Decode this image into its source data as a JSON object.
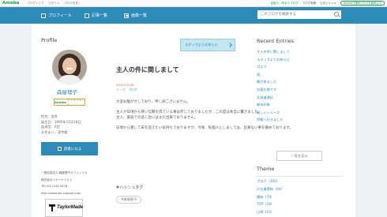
{
  "topbar": {
    "logo": "Ameba",
    "links": [
      "ブログトップ",
      "ログイン",
      "ブログを書く"
    ],
    "right_links": [
      "芸能人・有名人ブログ",
      "ブログ新着",
      "公式ジャンル"
    ],
    "signup_label": "Amebaで無料ブログを始めよう"
  },
  "nav": {
    "profile_label": "プロフィール",
    "entries_label": "記事一覧",
    "images_label": "画像一覧"
  },
  "search": {
    "placeholder": "このブログを検索する"
  },
  "profile": {
    "heading": "Profile",
    "name": "森屋理子",
    "badge_prefix": "Ameba",
    "badge_suffix": "オフィシャル",
    "info": [
      "性別：女性",
      "誕生日：1995年11月18日",
      "血液型：A型",
      "お住まい：東京都"
    ],
    "readers_button": "読者になる",
    "company_lines": [
      "一般社団法人 森屋理子オフィシャル",
      "株式会社ジャーナリスト",
      "TEL:03-1234-5678",
      "http://www.tee-support.com"
    ],
    "sponsor_logo": "TaylorMade"
  },
  "article": {
    "staff_button": "スタッフよりお知らせ",
    "title": "主人の件に関しまして",
    "meta_tag": "テーマ：",
    "meta_date": "2019-03-08",
    "meta_theme": "ブログ",
    "paragraphs": [
      [
        "大変お騒がせしており、申し訳ございません。"
      ],
      [
        "主人が日頃から厚い信頼を得ている事は存じておりましたが、この度は本当に驚きました。",
        "主人、家族での話し合いはまだ出来ておりません。"
      ],
      [
        "日頃から豊して末を迎えたい気持ちでおりますが、今後、私個人としましては、出来ない事を静めております。"
      ]
    ],
    "hashtag_heading": "#ハッシュタグ",
    "hashtag": "#森屋理子"
  },
  "recent": {
    "heading": "Recent Entries",
    "items": [
      "主人の件に関しまして",
      "スタッフよりお知らせ",
      "ゴルフ",
      "雨",
      "春が来ました",
      "お疲れ様です",
      "北海道遠征",
      "御朱印帳",
      "新しいシューズ",
      "京都へ行きました"
    ],
    "more_button": "一覧を見る"
  },
  "theme": {
    "heading": "Theme",
    "items": [
      "ブログ（300）",
      "お仕事関係（94）",
      "趣味（79）",
      "TOP（18）",
      "日常（15）"
    ]
  },
  "colors": {
    "brand": "#2d8bb8",
    "ameba": "#1aa350"
  }
}
